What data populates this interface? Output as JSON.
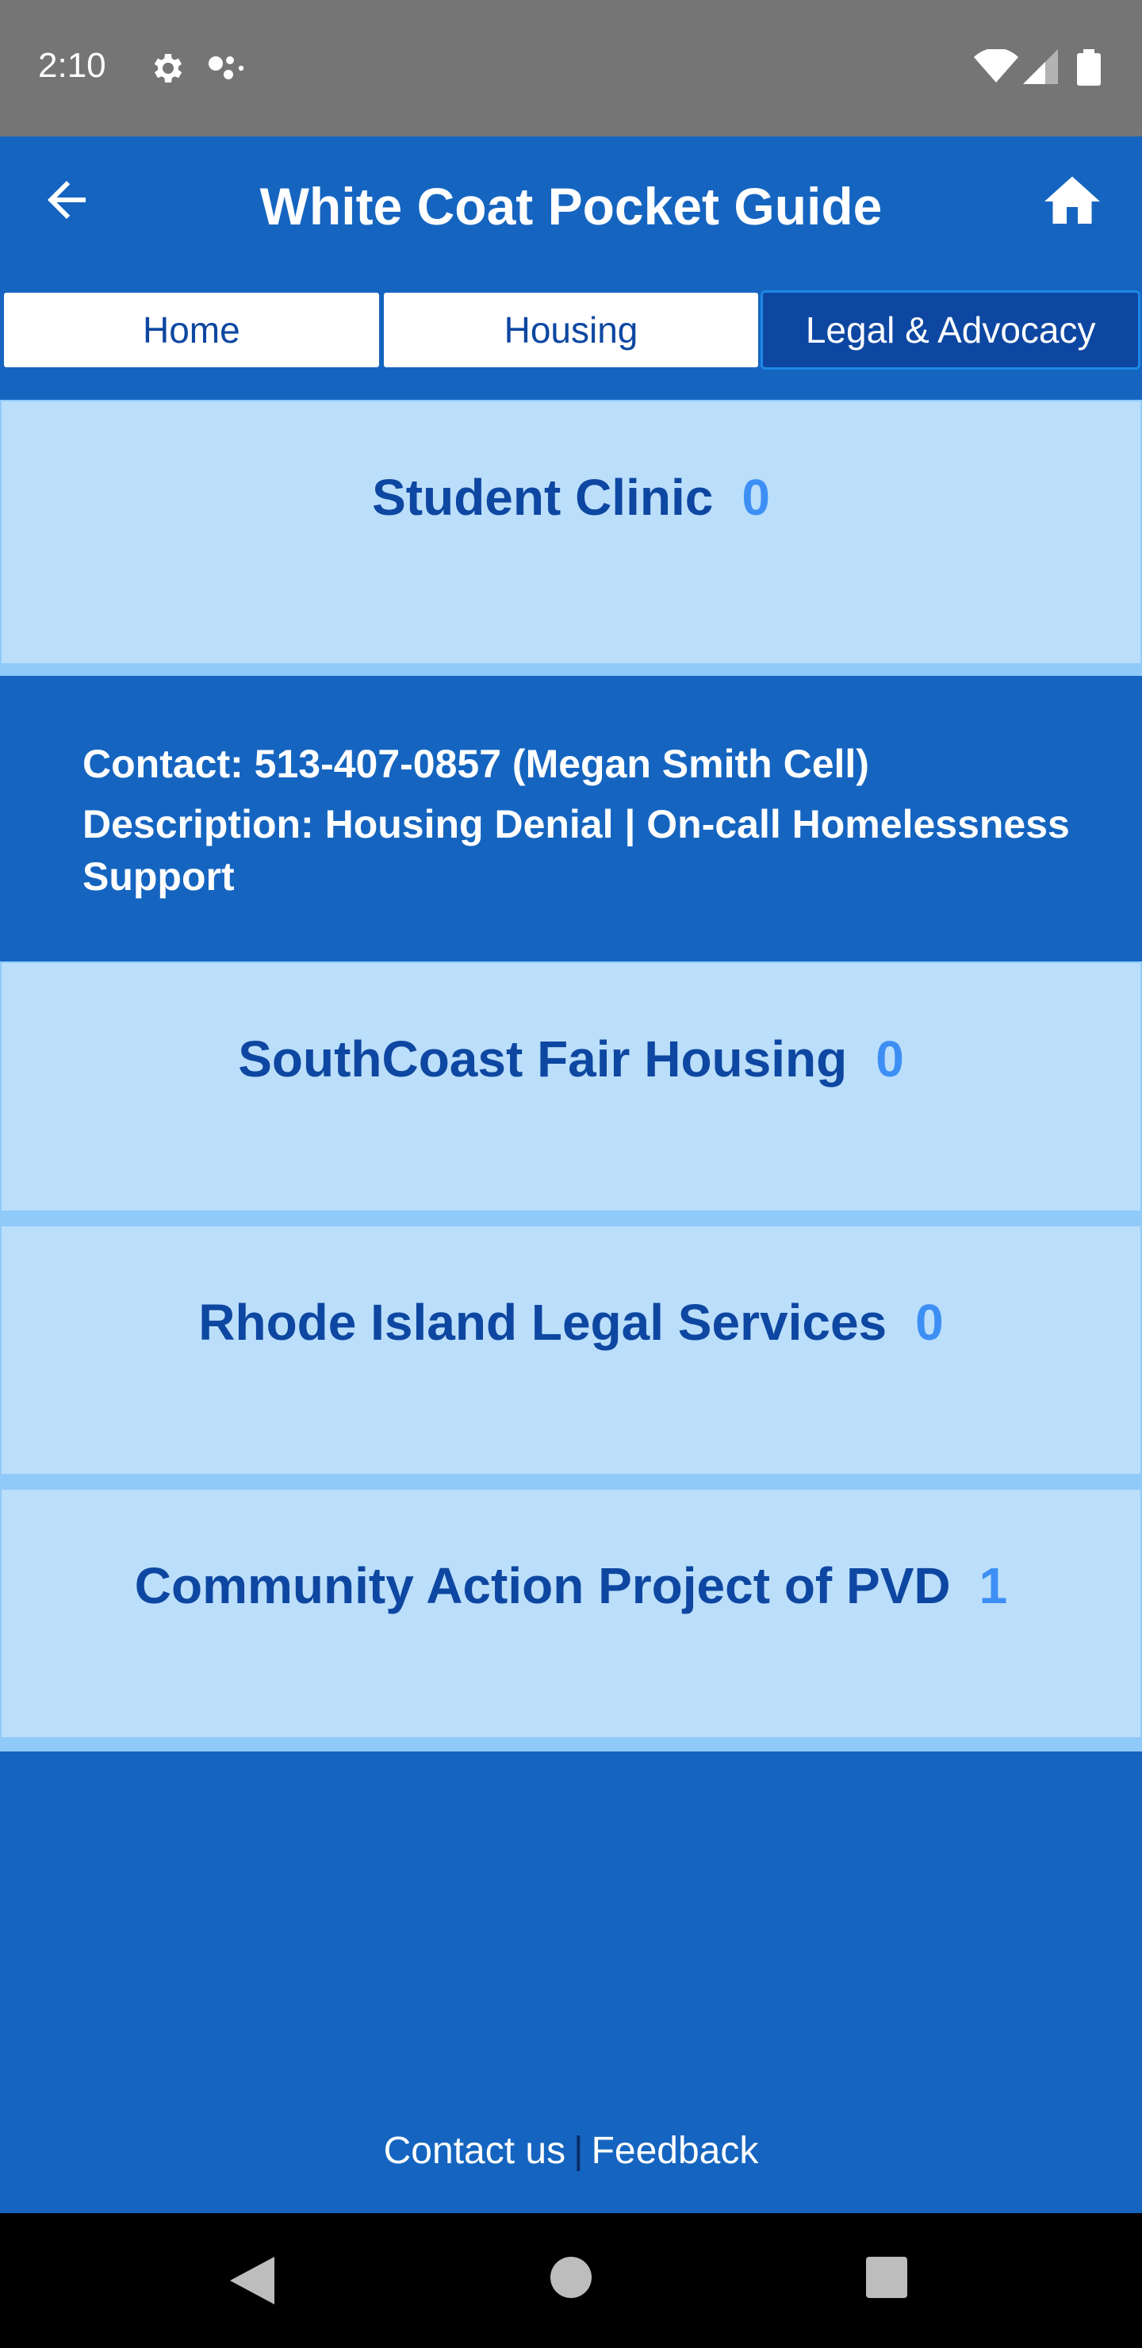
{
  "status_bar": {
    "time": "2:10"
  },
  "app_bar": {
    "title": "White Coat Pocket Guide"
  },
  "tabs": [
    {
      "label": "Home",
      "active": false
    },
    {
      "label": "Housing",
      "active": false
    },
    {
      "label": "Legal & Advocacy",
      "active": true
    }
  ],
  "resources": [
    {
      "name": "Student Clinic",
      "count": "0",
      "expanded": true,
      "contact": "Contact: 513-407-0857 (Megan Smith Cell)",
      "description": "Description: Housing Denial | On-call Homelessness Support"
    },
    {
      "name": "SouthCoast Fair Housing",
      "count": "0"
    },
    {
      "name": "Rhode Island Legal Services",
      "count": "0"
    },
    {
      "name": "Community Action Project of PVD",
      "count": "1"
    }
  ],
  "footer": {
    "contact_label": "Contact us",
    "separator": "|",
    "feedback_label": "Feedback"
  },
  "colors": {
    "primary": "#1565c0",
    "primary_dark": "#0d47a1",
    "card_bg": "#bbdefb",
    "count_accent": "#3d8ff5"
  }
}
